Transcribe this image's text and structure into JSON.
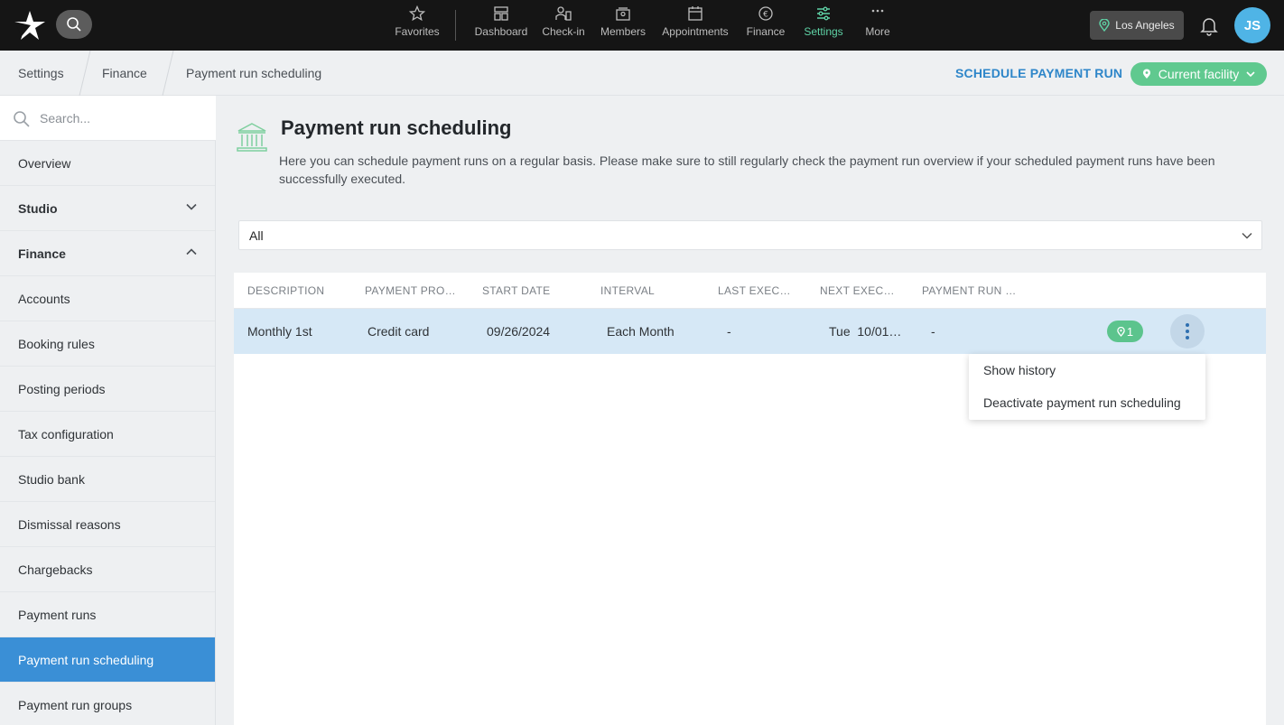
{
  "topbar": {
    "nav": [
      {
        "label": "Favorites",
        "icon": "star-icon"
      },
      {
        "label": "Dashboard",
        "icon": "dashboard-icon"
      },
      {
        "label": "Check-in",
        "icon": "check-in-icon"
      },
      {
        "label": "Members",
        "icon": "members-icon"
      },
      {
        "label": "Appointments",
        "icon": "calendar-icon"
      },
      {
        "label": "Finance",
        "icon": "euro-icon"
      },
      {
        "label": "Settings",
        "icon": "sliders-icon"
      },
      {
        "label": "More",
        "icon": "more-icon"
      }
    ],
    "active_nav": "Settings",
    "location": "Los Angeles",
    "avatar_initials": "JS"
  },
  "breadcrumb": {
    "items": [
      "Settings",
      "Finance",
      "Payment run scheduling"
    ]
  },
  "actions": {
    "schedule_label": "SCHEDULE PAYMENT RUN",
    "facility_label": "Current facility"
  },
  "sidebar": {
    "search_placeholder": "Search...",
    "items": [
      {
        "label": "Overview"
      },
      {
        "label": "Studio"
      },
      {
        "label": "Finance"
      },
      {
        "label": "Accounts"
      },
      {
        "label": "Booking rules"
      },
      {
        "label": "Posting periods"
      },
      {
        "label": "Tax configuration"
      },
      {
        "label": "Studio bank"
      },
      {
        "label": "Dismissal reasons"
      },
      {
        "label": "Chargebacks"
      },
      {
        "label": "Payment runs"
      },
      {
        "label": "Payment run scheduling"
      },
      {
        "label": "Payment run groups"
      }
    ],
    "active": "Payment run scheduling"
  },
  "page": {
    "title": "Payment run scheduling",
    "description": "Here you can schedule payment runs on a regular basis. Please make sure to still regularly check the payment run overview if your scheduled payment runs have been successfully executed.",
    "filter_value": "All"
  },
  "table": {
    "columns": [
      "DESCRIPTION",
      "PAYMENT PRO…",
      "START DATE",
      "INTERVAL",
      "LAST EXEC…",
      "NEXT EXEC…",
      "PAYMENT RUN …"
    ],
    "rows": [
      {
        "description": "Monthly 1st",
        "payment_profile": "Credit card",
        "start_date": "09/26/2024",
        "interval": "Each Month",
        "last_execution": "-",
        "next_execution": "Tue  10/01…",
        "payment_run": "-",
        "location_count": "1"
      }
    ]
  },
  "context_menu": {
    "items": [
      "Show history",
      "Deactivate payment run scheduling"
    ]
  },
  "colors": {
    "accent_green": "#5fd3a6",
    "badge_green": "#5cc48d",
    "active_blue": "#3a8fd6",
    "link_blue": "#2e86c9",
    "row_highlight": "#d6e8f6"
  }
}
